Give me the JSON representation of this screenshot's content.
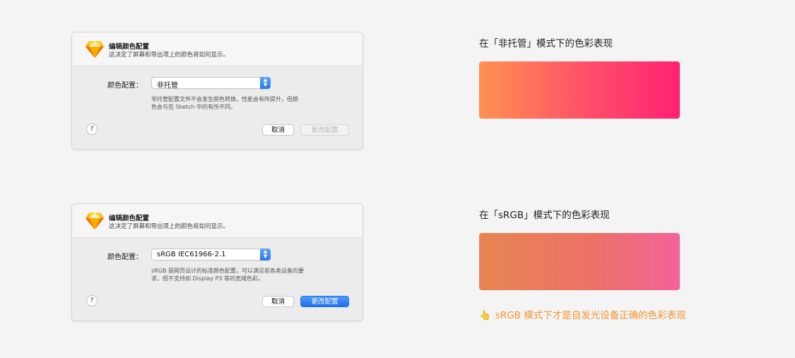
{
  "dialogs": [
    {
      "title": "编辑颜色配置",
      "subtitle": "这决定了屏幕和导出项上的颜色将如何显示。",
      "field_label": "颜色配置：",
      "selected": "非托管",
      "description_line1": "非托管配置文件不会发生颜色转换，性能会有所提升，但颜",
      "description_line2": "色会与在 Sketch 中的有所不同。",
      "help": "?",
      "cancel": "取消",
      "apply": "更改配置",
      "apply_enabled": false
    },
    {
      "title": "编辑颜色配置",
      "subtitle": "这决定了屏幕和导出项上的颜色将如何显示。",
      "field_label": "颜色配置：",
      "selected": "sRGB IEC61966-2.1",
      "description_line1": "sRGB 是网页设计的标准颜色配置，可以满足若各类设备的要",
      "description_line2": "求。但不支持如 Display P3 等的宽域色彩。",
      "help": "?",
      "cancel": "取消",
      "apply": "更改配置",
      "apply_enabled": true
    }
  ],
  "captions": [
    "在「非托管」模式下的色彩表现",
    "在「sRGB」模式下的色彩表现"
  ],
  "swatch_colors": [
    [
      "#ff9152",
      "#ff4e68",
      "#ff2173"
    ],
    [
      "#e78552",
      "#ec7366",
      "#f3639a"
    ]
  ],
  "note": {
    "icon": "pointing-hand-icon",
    "glyph": "👆",
    "text": "sRGB 模式下才是自发光设备正确的色彩表现",
    "color": "#f5932f"
  }
}
